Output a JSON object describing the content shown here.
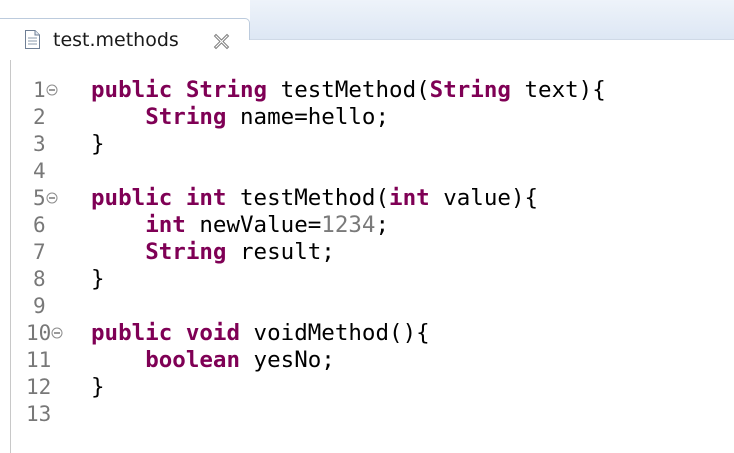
{
  "tab": {
    "title": "test.methods",
    "file_icon": "text-file-icon",
    "close_icon": "close-icon"
  },
  "editor": {
    "lines": [
      {
        "number": "1",
        "fold": true,
        "tokens": [
          {
            "t": "public",
            "k": "kw"
          },
          {
            "t": " "
          },
          {
            "t": "String",
            "k": "kw"
          },
          {
            "t": " testMethod("
          },
          {
            "t": "String",
            "k": "kw"
          },
          {
            "t": " text){"
          }
        ]
      },
      {
        "number": "2",
        "fold": false,
        "tokens": [
          {
            "t": "    "
          },
          {
            "t": "String",
            "k": "kw"
          },
          {
            "t": " name=hello;"
          }
        ]
      },
      {
        "number": "3",
        "fold": false,
        "tokens": [
          {
            "t": "}"
          }
        ]
      },
      {
        "number": "4",
        "fold": false,
        "tokens": []
      },
      {
        "number": "5",
        "fold": true,
        "tokens": [
          {
            "t": "public",
            "k": "kw"
          },
          {
            "t": " "
          },
          {
            "t": "int",
            "k": "kw"
          },
          {
            "t": " testMethod("
          },
          {
            "t": "int",
            "k": "kw"
          },
          {
            "t": " value){"
          }
        ]
      },
      {
        "number": "6",
        "fold": false,
        "tokens": [
          {
            "t": "    "
          },
          {
            "t": "int",
            "k": "kw"
          },
          {
            "t": " newValue="
          },
          {
            "t": "1234",
            "k": "num"
          },
          {
            "t": ";"
          }
        ]
      },
      {
        "number": "7",
        "fold": false,
        "tokens": [
          {
            "t": "    "
          },
          {
            "t": "String",
            "k": "kw"
          },
          {
            "t": " result;"
          }
        ]
      },
      {
        "number": "8",
        "fold": false,
        "tokens": [
          {
            "t": "}"
          }
        ]
      },
      {
        "number": "9",
        "fold": false,
        "tokens": []
      },
      {
        "number": "10",
        "fold": true,
        "tokens": [
          {
            "t": "public",
            "k": "kw"
          },
          {
            "t": " "
          },
          {
            "t": "void",
            "k": "kw"
          },
          {
            "t": " voidMethod(){"
          }
        ]
      },
      {
        "number": "11",
        "fold": false,
        "tokens": [
          {
            "t": "    "
          },
          {
            "t": "boolean",
            "k": "kw"
          },
          {
            "t": " yesNo;"
          }
        ]
      },
      {
        "number": "12",
        "fold": false,
        "tokens": [
          {
            "t": "}"
          }
        ]
      },
      {
        "number": "13",
        "fold": false,
        "tokens": []
      }
    ]
  },
  "colors": {
    "keyword": "#7f0055",
    "number_literal": "#7a7a7a",
    "line_number": "#787878",
    "tab_strip": "#dde7f4"
  }
}
